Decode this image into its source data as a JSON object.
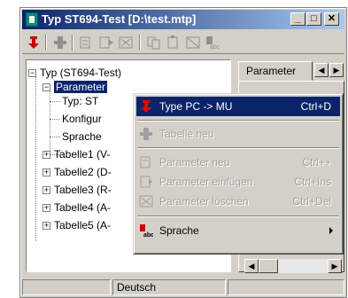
{
  "window": {
    "title": "Typ ST694-Test [D:\\test.mtp]",
    "minimize_label": "_",
    "maximize_label": "□",
    "close_label": "✕"
  },
  "toolbar": {
    "buttons": [
      "type-pc-mu-icon",
      "table-new-icon",
      "param-new-icon",
      "param-insert-icon",
      "param-delete-icon",
      "copy-icon",
      "paste-icon",
      "delete-icon",
      "language-icon"
    ]
  },
  "tree": {
    "root": "Typ (ST694-Test)",
    "parameter": "Parameter",
    "typ": "Typ: ST",
    "konfig": "Konfigur",
    "sprache": "Sprache",
    "tabelle1": "Tabelle1 (V-",
    "tabelle2": "Tabelle2 (D-",
    "tabelle3": "Tabelle3 (R-",
    "tabelle4": "Tabelle4 (A-",
    "tabelle5": "Tabelle5 (A-",
    "minus": "−",
    "plus": "+"
  },
  "right_panel": {
    "tab_label": "Parameter",
    "left_arrow": "◀",
    "right_arrow": "▶"
  },
  "statusbar": {
    "language": "Deutsch"
  },
  "context_menu": {
    "items": [
      {
        "label": "Type PC -> MU",
        "shortcut": "Ctrl+D"
      },
      {
        "label": "Tabelle neu",
        "shortcut": ""
      },
      {
        "label": "Parameter neu",
        "shortcut": "Ctrl++"
      },
      {
        "label": "Parameter einfügen",
        "shortcut": "Ctrl+Ins"
      },
      {
        "label": "Parameter löschen",
        "shortcut": "Ctrl+Del"
      },
      {
        "label": "Sprache",
        "shortcut": ""
      }
    ]
  },
  "colors": {
    "highlight": "#0a246a",
    "title_gradient_end": "#a6caf0",
    "face": "#d4d0c8"
  }
}
